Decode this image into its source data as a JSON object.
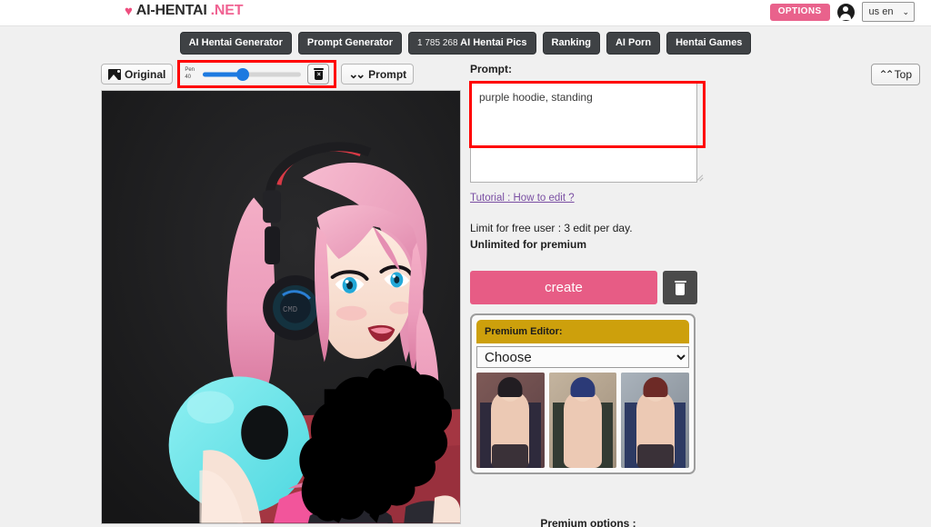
{
  "header": {
    "brand_heart": "♥",
    "brand_main": "AI-HENTAI",
    "brand_tld": ".NET",
    "options_label": "OPTIONS",
    "account_icon": "account-circle-icon",
    "language": "us en",
    "language_caret": "⌄"
  },
  "nav": {
    "items": [
      {
        "label": "AI Hentai Generator",
        "count": ""
      },
      {
        "label": "Prompt Generator",
        "count": ""
      },
      {
        "label": "AI Hentai Pics",
        "count": "1 785 268"
      },
      {
        "label": "Ranking",
        "count": ""
      },
      {
        "label": "AI Porn",
        "count": ""
      },
      {
        "label": "Hentai Games",
        "count": ""
      }
    ]
  },
  "toolbar": {
    "original_label": "Original",
    "original_icon": "image-icon",
    "pen_label_line1": "Pen",
    "pen_label_line2": "40",
    "pen_value": 40,
    "erase_icon": "trash-icon",
    "prompt_toggle_label": "Prompt",
    "prompt_toggle_icon": "chevron-double-down-icon"
  },
  "canvas": {
    "name": "image-edit-canvas",
    "description": "anime character with pink twin tails and headphones on dark background, black inpaint mask over torso"
  },
  "editor": {
    "prompt_title": "Prompt:",
    "prompt_value": "purple hoodie, standing",
    "prompt_placeholder": "",
    "tutorial_link": "Tutorial : How to edit ?",
    "limit_line1": "Limit for free user : 3 edit per day.",
    "limit_line2": "Unlimited for premium",
    "create_label": "create",
    "clear_icon": "trash-icon"
  },
  "premium": {
    "header": "Premium Editor:",
    "select_value": "Choose",
    "select_options": [
      "Choose"
    ],
    "select_caret": "⌄",
    "thumbnails": [
      {
        "name": "preset-thumbnail-1",
        "tag": "",
        "bg": "#7e5a57",
        "hair": "#221d22",
        "coat": "#2e2a3c"
      },
      {
        "name": "preset-thumbnail-2",
        "tag": "",
        "bg": "#b9a894",
        "hair": "#2b3a77",
        "coat": "#333b33"
      },
      {
        "name": "preset-thumbnail-3",
        "tag": "",
        "bg": "#9aa3ac",
        "hair": "#6d2a26",
        "coat": "#2d3a63"
      }
    ],
    "options_title": "Premium options :"
  },
  "top_button": {
    "label": "Top",
    "icon": "chevron-double-up-icon"
  },
  "colors": {
    "brand_pink": "#f06292",
    "options_pink": "#e9628c",
    "create_pink": "#e75c85",
    "nav_dark": "#3f4245",
    "premium_gold": "#cda00c",
    "highlight_red": "#ff0000",
    "slider_blue": "#1d7ae0",
    "page_bg": "#f0f0f0"
  }
}
